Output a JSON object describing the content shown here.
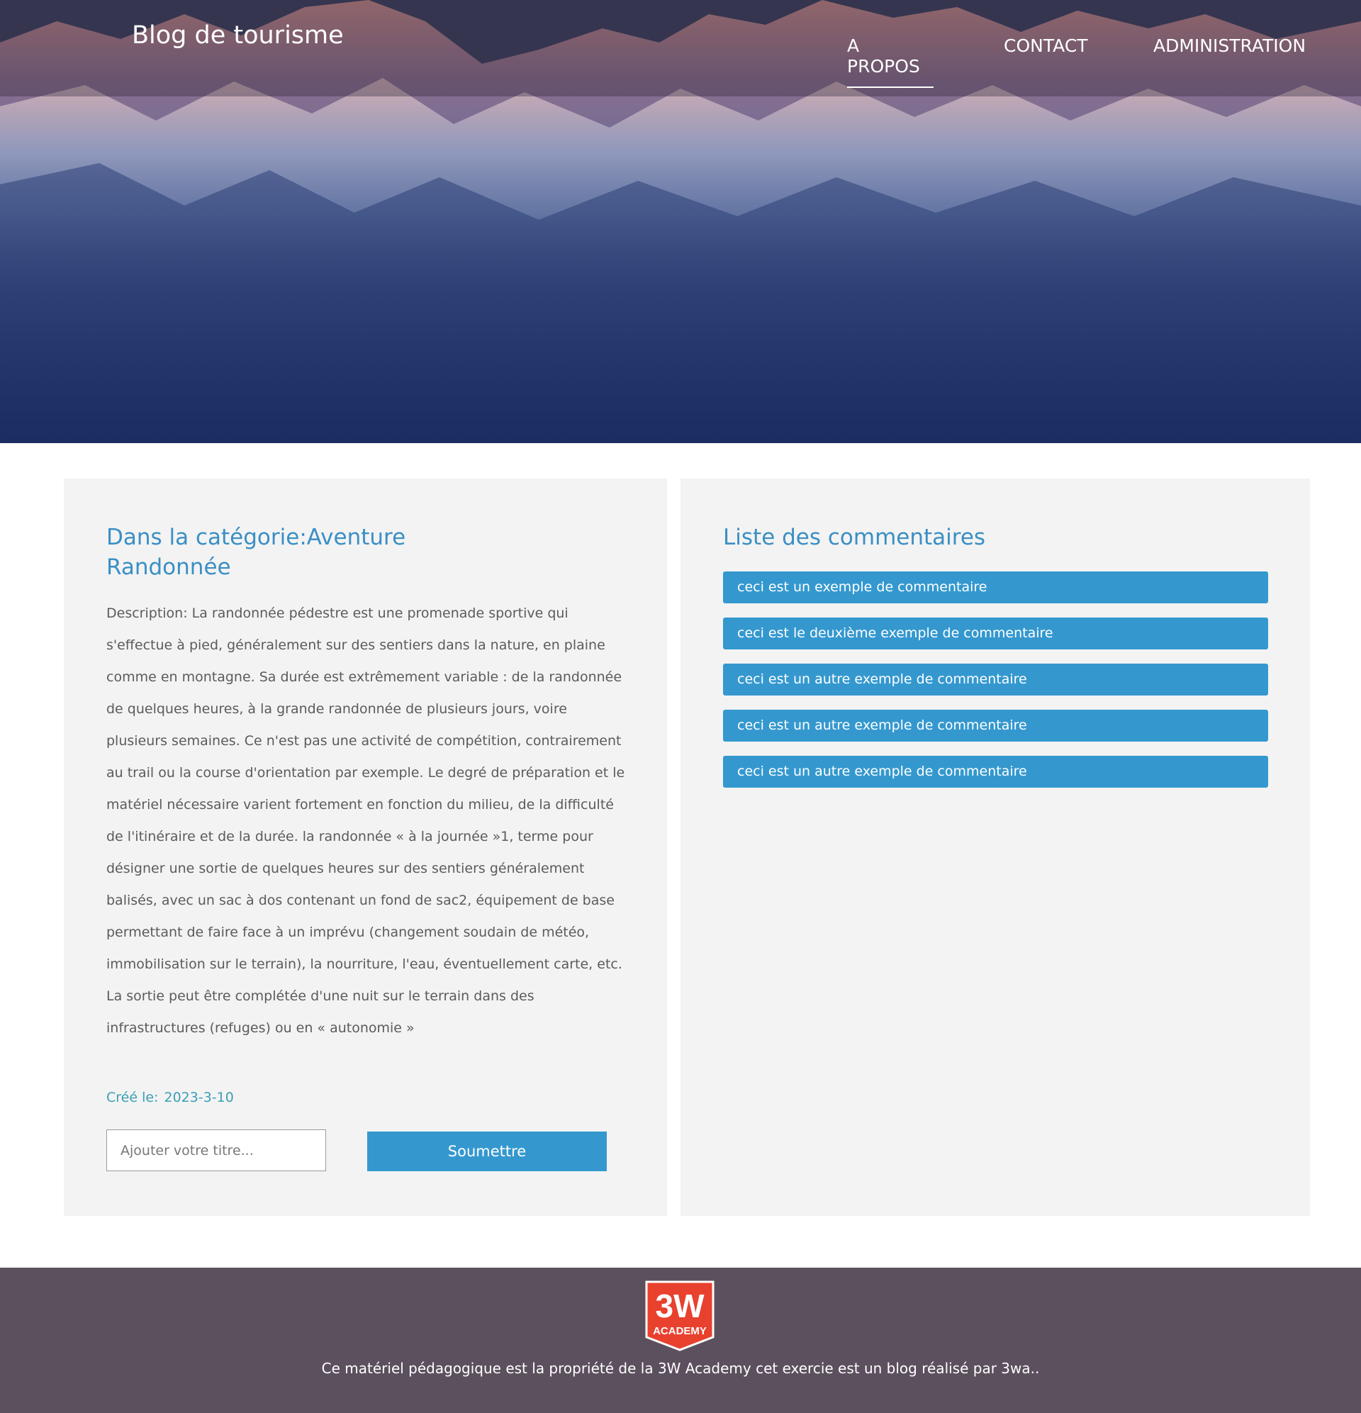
{
  "header": {
    "site_title": "Blog de tourisme",
    "nav": [
      {
        "label": "A PROPOS",
        "active": true
      },
      {
        "label": "CONTACT",
        "active": false
      },
      {
        "label": "ADMINISTRATION",
        "active": false
      }
    ]
  },
  "hero": {
    "image": "mountain-range-icon"
  },
  "article": {
    "category_label": "Dans la catégorie:Aventure",
    "title": "Randonnée",
    "description": "Description: La randonnée pédestre est une promenade sportive qui s'effectue à pied, généralement sur des sentiers dans la nature, en plaine comme en montagne. Sa durée est extrêmement variable : de la randonnée de quelques heures, à la grande randonnée de plusieurs jours, voire plusieurs semaines. Ce n'est pas une activité de compétition, contrairement au trail ou la course d'orientation par exemple. Le degré de préparation et le matériel nécessaire varient fortement en fonction du milieu, de la difficulté de l'itinéraire et de la durée. la randonnée « à la journée »1, terme pour désigner une sortie de quelques heures sur des sentiers généralement balisés, avec un sac à dos contenant un fond de sac2, équipement de base permettant de faire face à un imprévu (changement soudain de météo, immobilisation sur le terrain), la nourriture, l'eau, éventuellement carte, etc. La sortie peut être complétée d'une nuit sur le terrain dans des infrastructures (refuges) ou en « autonomie »",
    "created_label": "Créé le:",
    "created_date": "2023-3-10"
  },
  "form": {
    "input_value": "",
    "input_placeholder": "Ajouter votre titre...",
    "submit_label": "Soumettre"
  },
  "comments": {
    "heading": "Liste des commentaires",
    "items": [
      "ceci est un exemple de commentaire",
      "ceci est le deuxième exemple de commentaire",
      "ceci est un autre exemple de commentaire",
      "ceci est un autre exemple de commentaire",
      "ceci est un autre exemple de commentaire"
    ]
  },
  "footer": {
    "logo": {
      "main": "3W",
      "sub": "ACADEMY"
    },
    "text": "Ce matériel pédagogique est la propriété de la 3W Academy cet exercie est un blog réalisé par 3wa.."
  },
  "colors": {
    "accent": "#3498cf",
    "heading": "#3a8fc4",
    "date": "#3a9fb5",
    "card_bg": "#f3f3f3",
    "footer_bg": "#5c505e",
    "logo_red": "#e8412e"
  }
}
